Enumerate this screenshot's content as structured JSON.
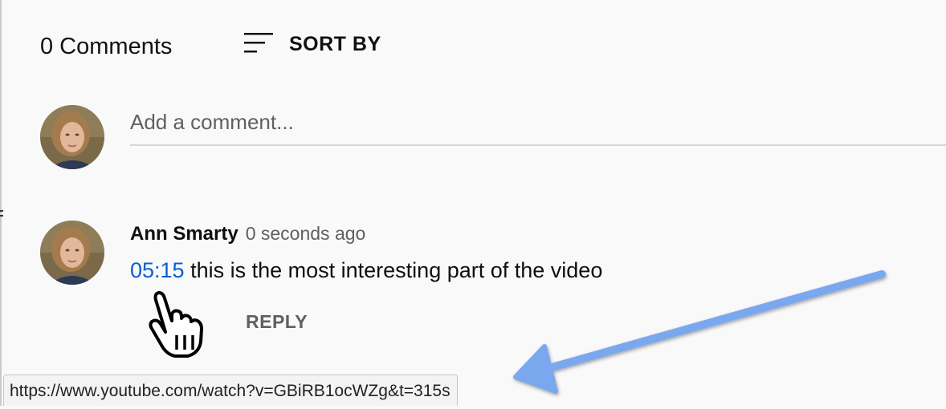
{
  "header": {
    "count_label": "0 Comments",
    "sort_label": "SORT BY",
    "sort_icon": "sort-lines-icon"
  },
  "composer": {
    "placeholder": "Add a comment..."
  },
  "comment": {
    "author": "Ann Smarty",
    "time": "0 seconds ago",
    "timestamp": "05:15",
    "text": " this is the most interesting part of the video",
    "reply_label": "REPLY"
  },
  "status_bar": {
    "url": "https://www.youtube.com/watch?v=GBiRB1ocWZg&t=315s"
  },
  "colors": {
    "link": "#065fd4",
    "annotation_arrow": "#7aa8ef",
    "background": "#f9f9f9"
  }
}
